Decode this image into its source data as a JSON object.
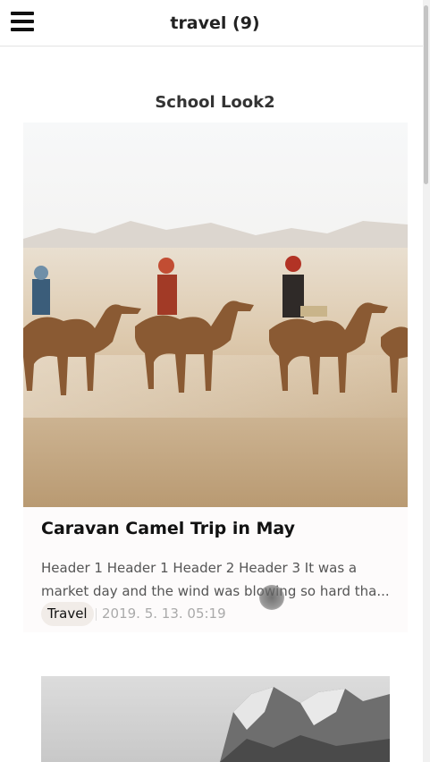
{
  "header": {
    "title": "travel (9)",
    "menu_icon": "hamburger-menu-icon"
  },
  "section": {
    "title": "School Look2"
  },
  "posts": [
    {
      "title": "Caravan Camel Trip in May",
      "excerpt": "Header 1 Header 1 Header 2 Header 3 It was a market day and the wind was blowing so hard tha...",
      "tag": "Travel",
      "date": "2019. 5. 13. 05:19"
    }
  ]
}
